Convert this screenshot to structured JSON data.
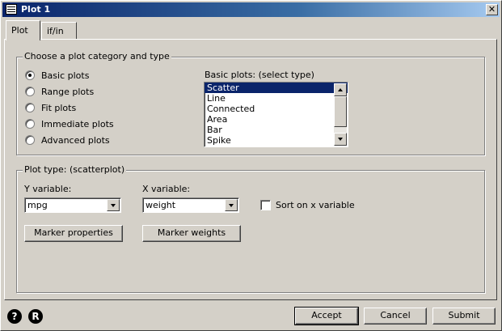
{
  "window": {
    "title": "Plot 1",
    "close_glyph": "✕"
  },
  "tabs": [
    {
      "label": "Plot"
    },
    {
      "label": "if/in"
    }
  ],
  "category_group": {
    "legend": "Choose a plot category and type",
    "radios": [
      {
        "label": "Basic plots",
        "checked": true
      },
      {
        "label": "Range plots",
        "checked": false
      },
      {
        "label": "Fit plots",
        "checked": false
      },
      {
        "label": "Immediate plots",
        "checked": false
      },
      {
        "label": "Advanced plots",
        "checked": false
      }
    ],
    "list_label": "Basic plots: (select type)",
    "list_items": [
      "Scatter",
      "Line",
      "Connected",
      "Area",
      "Bar",
      "Spike"
    ],
    "selected_item": "Scatter"
  },
  "plot_type_group": {
    "legend": "Plot type: (scatterplot)",
    "y_label": "Y variable:",
    "y_value": "mpg",
    "x_label": "X variable:",
    "x_value": "weight",
    "sort_label": "Sort on x variable",
    "marker_properties": "Marker properties",
    "marker_weights": "Marker weights"
  },
  "footer": {
    "help_icon": "?",
    "r_icon": "R",
    "accept": "Accept",
    "cancel": "Cancel",
    "submit": "Submit"
  },
  "colors": {
    "titlebar": "#0a246a",
    "selection": "#0a246a",
    "face": "#d4d0c8"
  }
}
